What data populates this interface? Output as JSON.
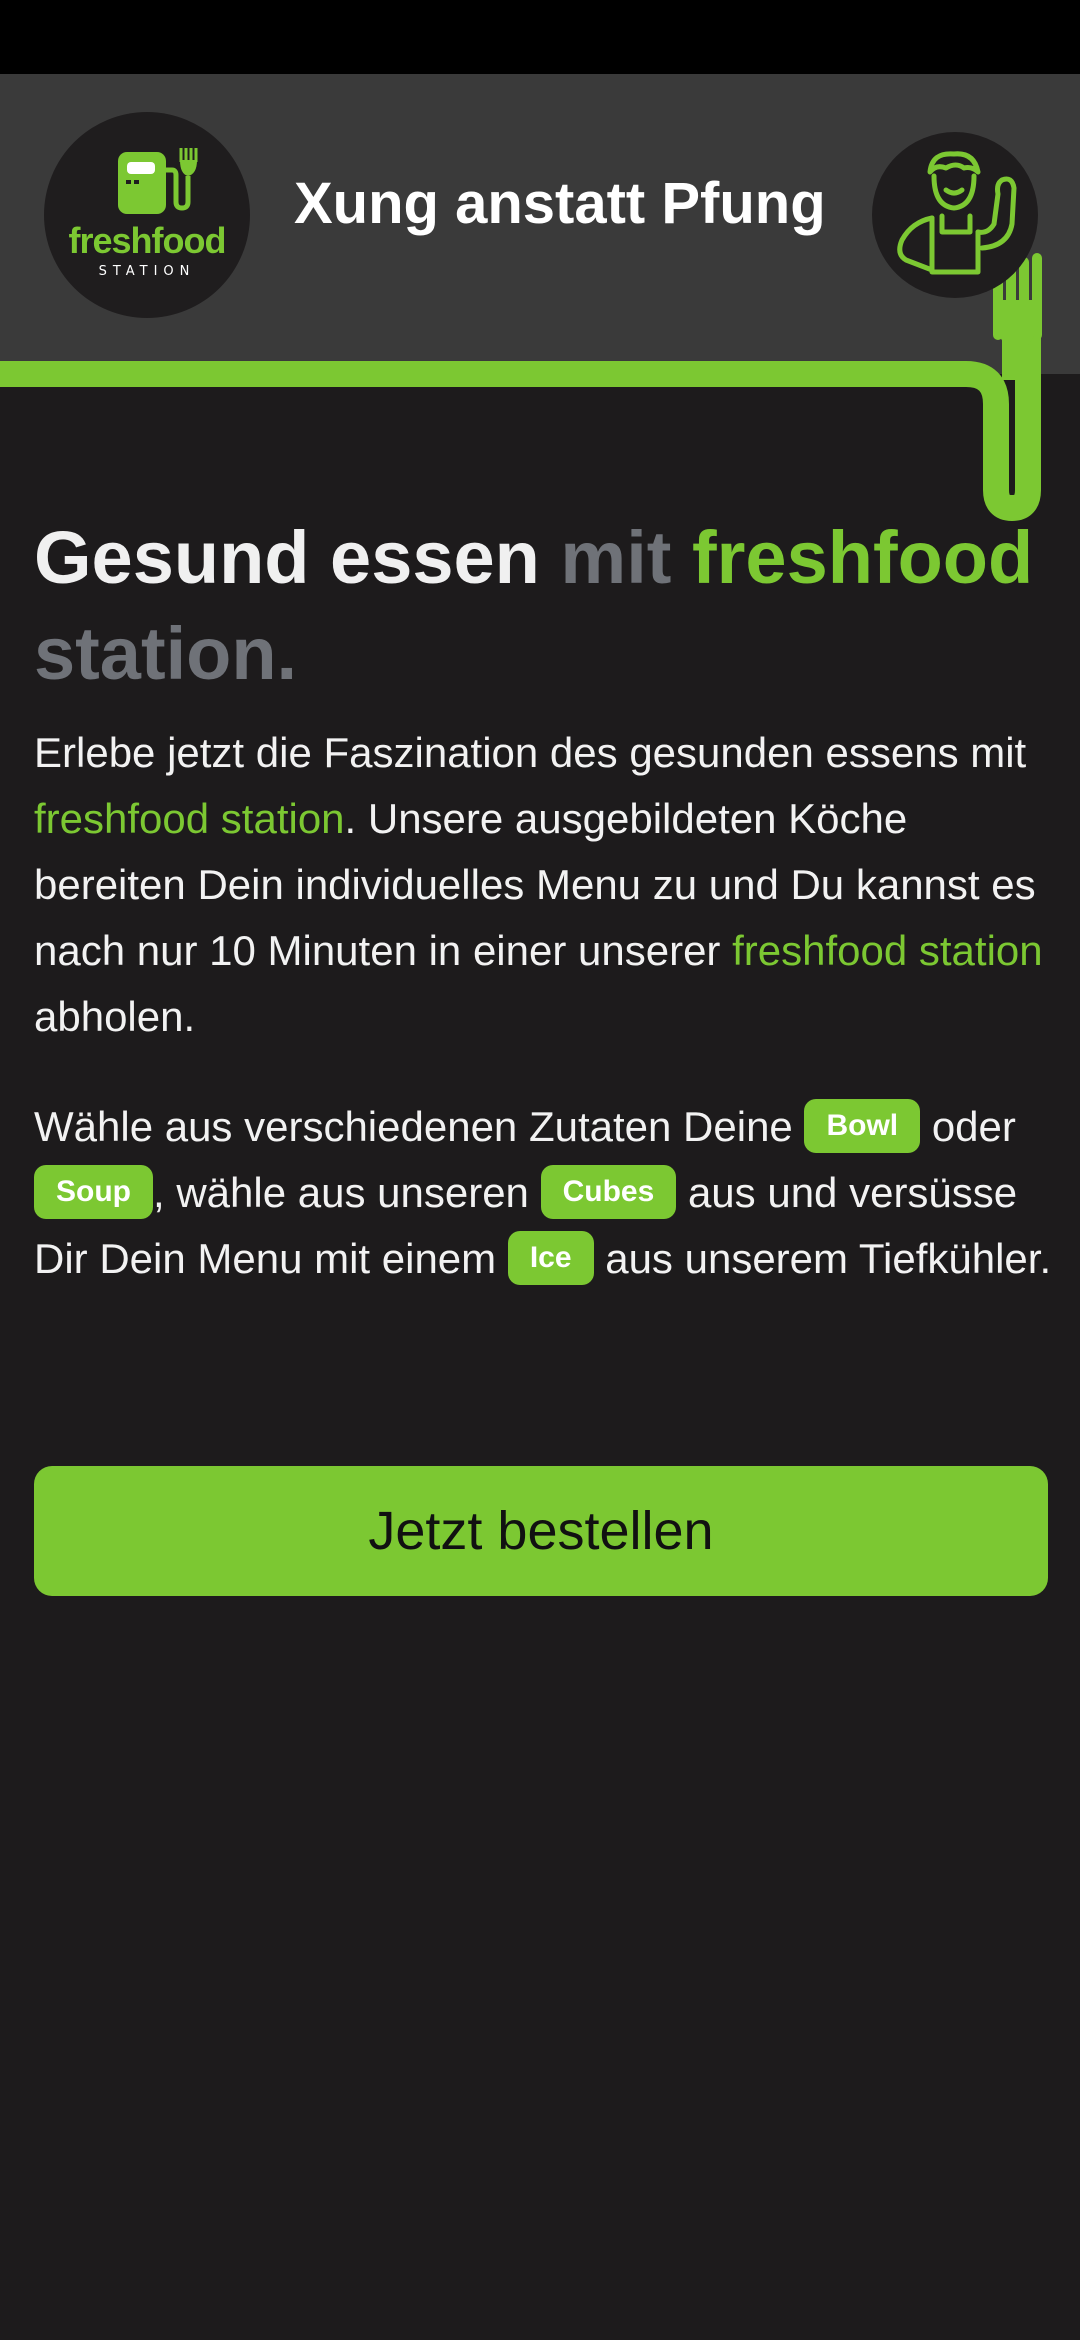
{
  "header": {
    "logo": {
      "brand_part1": "fresh",
      "brand_part2": "food",
      "brand_sub": "STATION"
    },
    "title": "Xung anstatt Pfung",
    "avatar_icon": "user-profile-icon"
  },
  "headline": {
    "part1": "Gesund essen",
    "part2": "mit",
    "part3": "freshfood",
    "part4": "station."
  },
  "intro": {
    "t1": "Erlebe jetzt die Faszination des gesunden essens mit",
    "l1": "freshfood station",
    "t2": ". Unsere ausgebildeten Köche bereiten Dein individuelles Menu zu und Du kannst es nach nur 10 Minuten in einer unserer",
    "l2": "freshfood station",
    "t3": "abholen."
  },
  "choice": {
    "t1": "Wähle aus verschiedenen Zutaten Deine",
    "chip1": "Bowl",
    "t2": "oder",
    "chip2": "Soup",
    "t3": ", wähle aus unseren",
    "chip3": "Cubes",
    "t4": "aus und versüsse Dir Dein Menu mit einem",
    "chip4": "Ice",
    "t5": "aus unserem Tiefkühler."
  },
  "cta": {
    "label": "Jetzt bestellen"
  },
  "colors": {
    "accent": "#7cc832",
    "background": "#1d1b1c",
    "header": "#3a3a3a"
  }
}
